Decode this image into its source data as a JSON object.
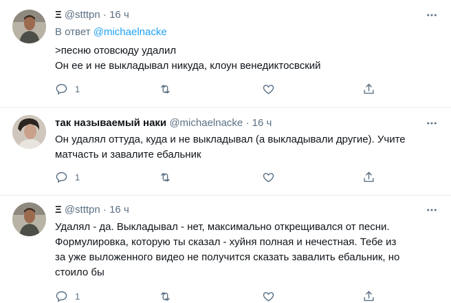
{
  "tweets": [
    {
      "name": "Ξ",
      "handle": "@stttpn",
      "separator": "·",
      "time": "16 ч",
      "replying_prefix": "В ответ",
      "replying_to": "@michaelnacke",
      "lines": [
        ">песню отовсюду удалил",
        "Он ее и не выкладывал никуда, клоун венедиктосвский"
      ],
      "reply_count": "1"
    },
    {
      "name": "так называемый наки",
      "handle": "@michaelnacke",
      "separator": "·",
      "time": "16 ч",
      "lines": [
        "Он удалял оттуда, куда и не выкладывал (а выкладывали другие). Учите",
        "матчасть и завалите ебальник"
      ],
      "reply_count": "1"
    },
    {
      "name": "Ξ",
      "handle": "@stttpn",
      "separator": "·",
      "time": "16 ч",
      "lines": [
        "Удалял - да. Выкладывал - нет, максимально открещивался от песни.",
        "Формулировка, которую ты сказал - хуйня полная и нечестная. Тебе из",
        "за уже выложенного видео не получится сказать завалить ебальник, но",
        "стоило бы"
      ],
      "reply_count": "1"
    }
  ],
  "colors": {
    "text": "#0f1419",
    "secondary": "#5b7083",
    "link": "#1da1f2",
    "divider": "#ebeef0"
  },
  "icons": [
    "avatar",
    "more-icon",
    "reply-icon",
    "retweet-icon",
    "like-icon",
    "share-icon"
  ]
}
